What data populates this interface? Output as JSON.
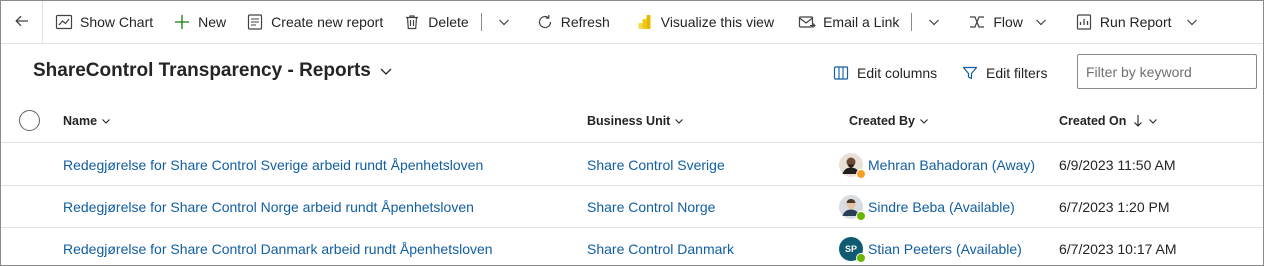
{
  "commandbar": {
    "show_chart": "Show Chart",
    "new": "New",
    "create_report": "Create new report",
    "delete": "Delete",
    "refresh": "Refresh",
    "visualize": "Visualize this view",
    "email_link": "Email a Link",
    "flow": "Flow",
    "run_report": "Run Report"
  },
  "view": {
    "title": "ShareControl Transparency - Reports",
    "edit_columns": "Edit columns",
    "edit_filters": "Edit filters",
    "filter_placeholder": "Filter by keyword"
  },
  "grid": {
    "columns": {
      "name": "Name",
      "business_unit": "Business Unit",
      "created_by": "Created By",
      "created_on": "Created On"
    },
    "rows": [
      {
        "name": "Redegjørelse for Share Control Sverige arbeid rundt Åpenhetsloven",
        "business_unit": "Share Control Sverige",
        "created_by": "Mehran Bahadoran (Away)",
        "created_on": "6/9/2023 11:50 AM",
        "presence_color": "#f7a128"
      },
      {
        "name": "Redegjørelse for Share Control Norge arbeid rundt Åpenhetsloven",
        "business_unit": "Share Control Norge",
        "created_by": "Sindre Beba (Available)",
        "created_on": "6/7/2023 1:20 PM",
        "presence_color": "#6bb700"
      },
      {
        "name": "Redegjørelse for Share Control Danmark arbeid rundt Åpenhetsloven",
        "business_unit": "Share Control Danmark",
        "created_by": "Stian Peeters (Available)",
        "created_on": "6/7/2023 10:17 AM",
        "presence_color": "#6bb700",
        "initials": "SP",
        "avatar_color": "#0e5b72"
      }
    ]
  },
  "colors": {
    "link": "#115ea3",
    "accent_visualize": "#f2c811"
  }
}
